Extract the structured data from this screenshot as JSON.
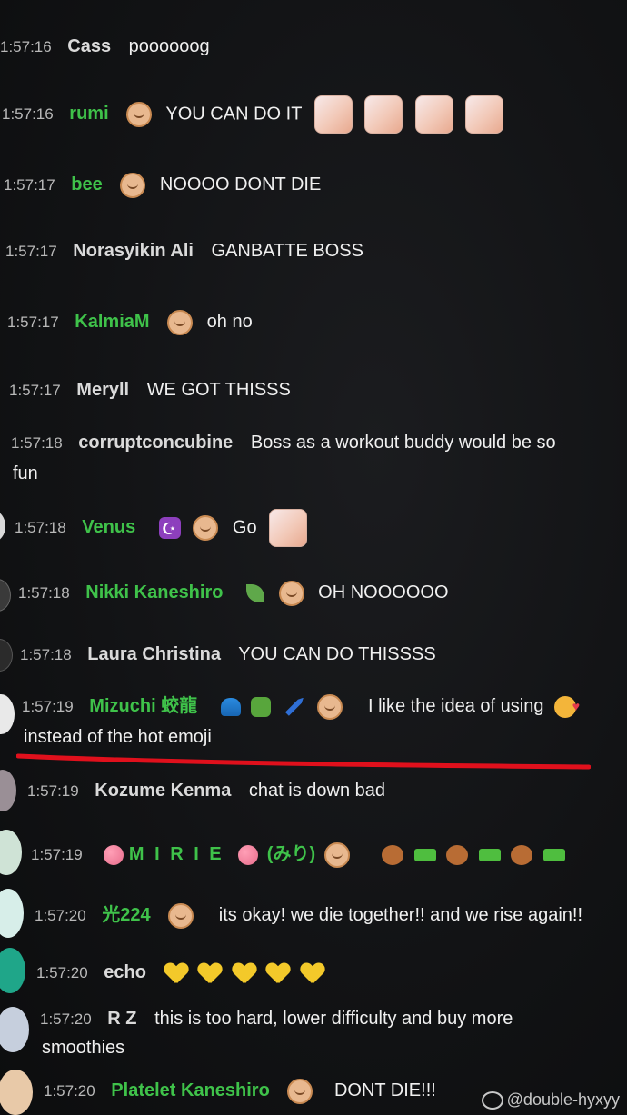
{
  "chat": {
    "messages": [
      {
        "time": "1:57:16",
        "author": "Cass",
        "message": "poooooog"
      },
      {
        "time": "1:57:16",
        "author": "rumi",
        "message": "YOU CAN DO IT"
      },
      {
        "time": "1:57:17",
        "author": "bee",
        "message": "NOOOO DONT DIE"
      },
      {
        "time": "1:57:17",
        "author": "Norasyikin Ali",
        "message": "GANBATTE BOSS"
      },
      {
        "time": "1:57:17",
        "author": "KalmiaM",
        "message": "oh no"
      },
      {
        "time": "1:57:17",
        "author": "Meryll",
        "message": "WE GOT THISSS"
      },
      {
        "time": "1:57:18",
        "author": "corruptconcubine",
        "message": "Boss as a workout buddy would be so",
        "message_cont": "fun"
      },
      {
        "time": "1:57:18",
        "author": "Venus",
        "message": "Go"
      },
      {
        "time": "1:57:18",
        "author": "Nikki Kaneshiro",
        "message": "OH NOOOOOO"
      },
      {
        "time": "1:57:18",
        "author": "Laura Christina",
        "message": "YOU CAN DO THISSSS"
      },
      {
        "time": "1:57:19",
        "author": "Mizuchi 蛟龍",
        "message": "I like the idea of using",
        "message_cont": "instead of the hot emoji"
      },
      {
        "time": "1:57:19",
        "author": "Kozume Kenma",
        "message": "chat is down bad"
      },
      {
        "time": "1:57:19",
        "author": "M I R I E",
        "author_suffix": "(みり)",
        "message": ""
      },
      {
        "time": "1:57:20",
        "author": "光224",
        "message": "its okay! we die together!! and we rise again!!"
      },
      {
        "time": "1:57:20",
        "author": "echo",
        "message": ""
      },
      {
        "time": "1:57:20",
        "author": "R Z",
        "message": "this is too hard, lower difficulty and buy more",
        "message_cont": "smoothies"
      },
      {
        "time": "1:57:20",
        "author": "Platelet Kaneshiro",
        "message": "DONT DIE!!!"
      }
    ]
  },
  "watermark": {
    "text": "@double-hyxyy"
  },
  "colors": {
    "member": "#3fc24a",
    "underline": "#e0101c",
    "background": "#121315"
  },
  "icons": [
    "member-badge-icon",
    "emote-icon",
    "yellow-heart-icon",
    "crescent-moon-icon",
    "herb-icon",
    "wave-icon",
    "ogre-icon",
    "wrench-icon",
    "kiss-face-icon",
    "bear-icon",
    "water-gun-icon",
    "dango-icon"
  ]
}
